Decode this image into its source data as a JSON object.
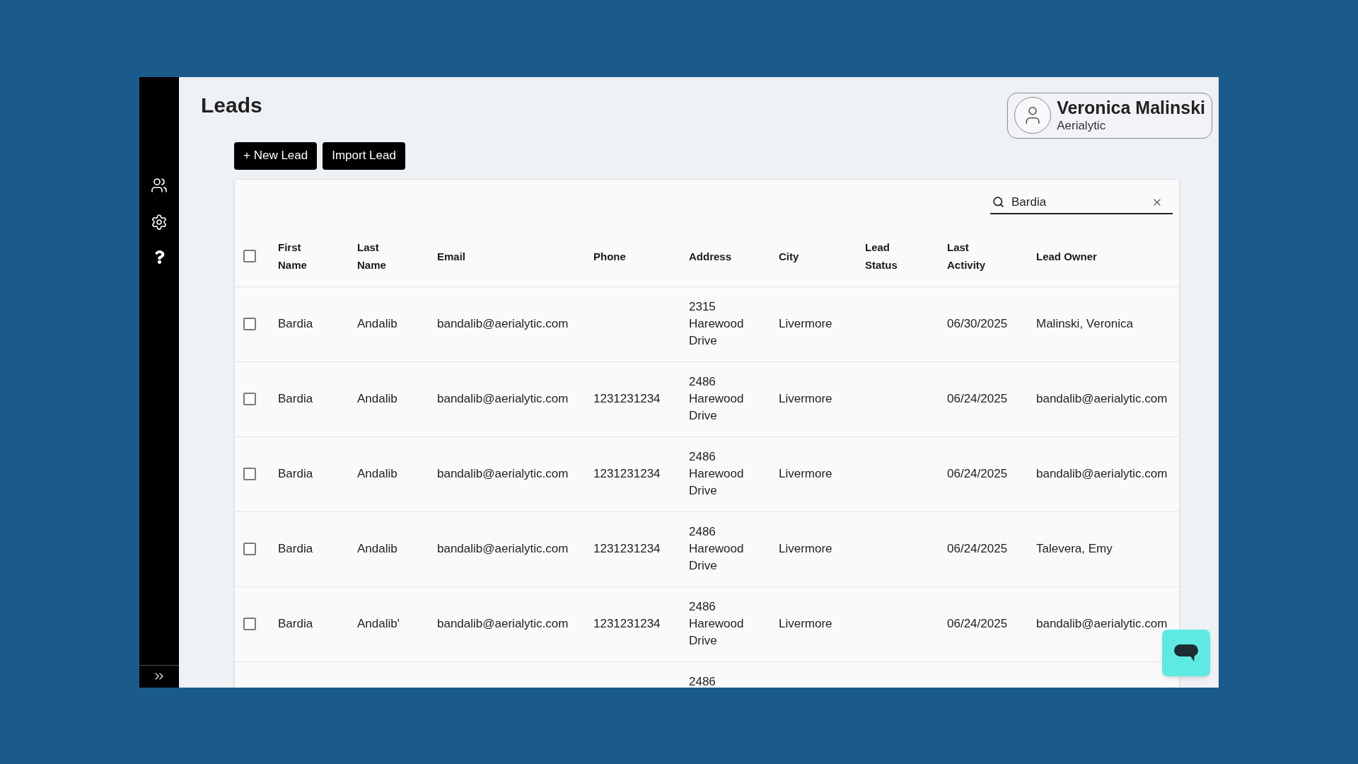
{
  "page": {
    "title": "Leads"
  },
  "actions": [
    "+ New Lead",
    "Import Lead"
  ],
  "user": {
    "name": "Veronica Malinski",
    "company": "Aerialytic"
  },
  "search": {
    "value": "Bardia"
  },
  "table": {
    "select_all": {
      "checked": false
    },
    "columns": [
      "First Name",
      "Last Name",
      "Email",
      "Phone",
      "Address",
      "City",
      "Lead Status",
      "Last Activity",
      "Lead Owner"
    ],
    "rows": [
      {
        "checked": false,
        "first_name": "Bardia",
        "last_name": "Andalib",
        "email": "bandalib@aerialytic.com",
        "address": "2315 Harewood Drive",
        "city": "Livermore",
        "last_activity": "06/30/2025",
        "lead_owner": "Malinski, Veronica"
      },
      {
        "checked": false,
        "first_name": "Bardia",
        "last_name": "Andalib",
        "email": "bandalib@aerialytic.com",
        "phone": "1231231234",
        "address": "2486 Harewood Drive",
        "city": "Livermore",
        "last_activity": "06/24/2025",
        "lead_owner": "bandalib@aerialytic.com"
      },
      {
        "checked": false,
        "first_name": "Bardia",
        "last_name": "Andalib",
        "email": "bandalib@aerialytic.com",
        "phone": "1231231234",
        "address": "2486 Harewood Drive",
        "city": "Livermore",
        "last_activity": "06/24/2025",
        "lead_owner": "bandalib@aerialytic.com"
      },
      {
        "checked": false,
        "first_name": "Bardia",
        "last_name": "Andalib",
        "email": "bandalib@aerialytic.com",
        "phone": "1231231234",
        "address": "2486 Harewood Drive",
        "city": "Livermore",
        "last_activity": "06/24/2025",
        "lead_owner": "Talevera, Emy"
      },
      {
        "checked": false,
        "first_name": "Bardia",
        "last_name": "Andalib'",
        "email": "bandalib@aerialytic.com",
        "phone": "1231231234",
        "address": "2486 Harewood Drive",
        "city": "Livermore",
        "last_activity": "06/24/2025",
        "lead_owner": "bandalib@aerialytic.com"
      },
      {
        "address": "2486"
      }
    ]
  }
}
